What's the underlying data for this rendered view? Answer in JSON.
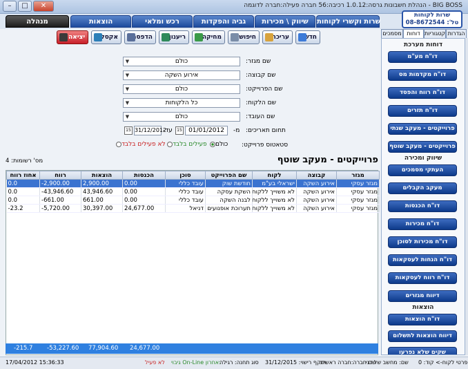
{
  "window": {
    "title": "BIG BOSS - הנהלת חשבונות גרסה:1.0.12 רכיבה:56 חברה פעילה:חברה לדוגמה",
    "minimize": "–",
    "maximize": "□",
    "close": "✕"
  },
  "support": {
    "line1": "שרות לקוחות",
    "line2": "טל': 08-8672544"
  },
  "topmenu": [
    "שרות וקשרי לקוחות",
    "שיווק \\ מכירות",
    "גביה והפקדות",
    "רכש ומלאי",
    "הוצאות",
    "מנהלה"
  ],
  "toolbar": {
    "new": "חדש",
    "edit": "עריכה",
    "search": "חיפוש",
    "delete": "מחיקה",
    "refresh": "ריענון",
    "print": "הדפסה",
    "excel": "אקסל",
    "exit": "יציאה"
  },
  "sidetabs": [
    "הגדרות",
    "קטגוריות",
    "דוחות",
    "מסמכים"
  ],
  "sidepanel": {
    "section1": "דוחות מערכת",
    "section1_items": [
      "דו\"ח מע\"מ",
      "דו\"ח מקדמות מס",
      "דו\"ח רווח והפסד",
      "דו\"ח תזרים",
      "פרוייקטים - מעקב שנתי",
      "פרוייקטים - מעקב שוטף"
    ],
    "section2": "שיווק ומכירה",
    "section2_items": [
      "העתקי מסמכים",
      "מעקב הקבלים",
      "דו\"ח הכנסות",
      "דו\"ח מכירות",
      "דו\"ח מכירות לסוכן",
      "דו\"ח הנחות לעסקאות",
      "דו\"ח רווח לעסקאות",
      "דיווח מגזרים"
    ],
    "section3": "הוצאות",
    "section3_items": [
      "דו\"ח הוצאות",
      "דיווח הוצאות לתשלום",
      "שקים שלא נפרעו"
    ]
  },
  "form": {
    "sector_label": "שם מגזר:",
    "sector_value": "כולם",
    "group_label": "שם קבוצה:",
    "group_value": "אירוע השקה",
    "project_label": "שם הפרוייקט:",
    "project_value": "כולם",
    "client_label": "שם הלקוח:",
    "client_value": "כל הלקוחות",
    "worker_label": "שם העובד:",
    "worker_value": "כולם",
    "dates_label": "תחום תאריכים:",
    "from_label": "מ-",
    "from_value": "01/01/2012",
    "to_label": "עד-",
    "to_value": "31/12/2012",
    "status_label": "סטאטוס פרוייקט:",
    "status_all": "כולם",
    "status_active": "פעילים בלבד",
    "status_inactive": "לא פעילים בלבד"
  },
  "report": {
    "title": "פרוייקטים - מעקב שוטף",
    "count_label": "מס' רשומות:",
    "count_value": "4"
  },
  "table": {
    "columns": [
      "מגזר",
      "קבוצה",
      "לקוח",
      "שם הפרוייקט",
      "סוכן",
      "הכנסות",
      "הוצאות",
      "רווח",
      "אחוז רווח"
    ],
    "rows": [
      [
        "מגזר עסקי",
        "אירוע השקה",
        "ישראלי בע\"מ",
        "חודשת שוק",
        "עובד כללי",
        "0.00",
        "2,900.00",
        "-2,900.00",
        "0.0"
      ],
      [
        "מגזר עסקי",
        "אירוע השקה",
        "לא משוייך ללקוח",
        "השקת עסקה",
        "עובד כללי",
        "0.00",
        "43,946.60",
        "-43,946.60",
        "0.0"
      ],
      [
        "מגזר עסקי",
        "אירוע השקה",
        "לא משוייך ללקוח",
        "לבנה השקה",
        "עובד כללי",
        "0.00",
        "661.00",
        "-661.00",
        "0.0"
      ],
      [
        "מגזר עסקי",
        "אירוע השקה",
        "לא משוייך ללקוח",
        "תערוכת אופנועים",
        "דניאל",
        "24,677.00",
        "30,397.00",
        "-5,720.00",
        "-23.2"
      ]
    ],
    "totals": {
      "income": "24,677.00",
      "expenses": "77,904.60",
      "profit": "-53,227.60",
      "percent": "-215.7"
    }
  },
  "statusbar": {
    "user": "שם: מחשב של דני",
    "company": "שם חברה:חברה ראשית",
    "license": "תוקף רישוי: 31/12/2015",
    "conn": "סוג תחנה: רגילה",
    "backup_label": "גיבוי On-Line אחרון:",
    "backup_value": "לא פעיל",
    "datetime": "17/04/2012 15:36:33",
    "client_label": "פרטי לקוח-> קוד: 0"
  },
  "colors": {
    "accent": "#0d3a8a",
    "selection": "#3b73d0",
    "exit": "#c8202a"
  }
}
